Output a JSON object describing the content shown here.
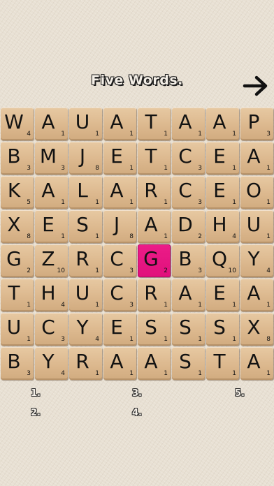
{
  "game": {
    "title": "Five Words.",
    "next_icon": "arrow-right-icon",
    "selected_color": "#e8148a"
  },
  "board": {
    "rows": [
      [
        {
          "l": "W",
          "s": "4"
        },
        {
          "l": "A",
          "s": "1"
        },
        {
          "l": "U",
          "s": "1"
        },
        {
          "l": "A",
          "s": "1"
        },
        {
          "l": "T",
          "s": "1"
        },
        {
          "l": "A",
          "s": "1"
        },
        {
          "l": "A",
          "s": "1"
        },
        {
          "l": "P",
          "s": "3"
        }
      ],
      [
        {
          "l": "B",
          "s": "3"
        },
        {
          "l": "M",
          "s": "3"
        },
        {
          "l": "J",
          "s": "8"
        },
        {
          "l": "E",
          "s": "1"
        },
        {
          "l": "T",
          "s": "1"
        },
        {
          "l": "C",
          "s": "3"
        },
        {
          "l": "E",
          "s": "1"
        },
        {
          "l": "A",
          "s": "1"
        }
      ],
      [
        {
          "l": "K",
          "s": "5"
        },
        {
          "l": "A",
          "s": "1"
        },
        {
          "l": "L",
          "s": "1"
        },
        {
          "l": "A",
          "s": "1"
        },
        {
          "l": "R",
          "s": "1"
        },
        {
          "l": "C",
          "s": "3"
        },
        {
          "l": "E",
          "s": "1"
        },
        {
          "l": "O",
          "s": "1"
        }
      ],
      [
        {
          "l": "X",
          "s": "8"
        },
        {
          "l": "E",
          "s": "1"
        },
        {
          "l": "S",
          "s": "1"
        },
        {
          "l": "J",
          "s": "8"
        },
        {
          "l": "A",
          "s": "1"
        },
        {
          "l": "D",
          "s": "2"
        },
        {
          "l": "H",
          "s": "4"
        },
        {
          "l": "U",
          "s": "1"
        }
      ],
      [
        {
          "l": "G",
          "s": "2"
        },
        {
          "l": "Z",
          "s": "10"
        },
        {
          "l": "R",
          "s": "1"
        },
        {
          "l": "C",
          "s": "3"
        },
        {
          "l": "G",
          "s": "2",
          "selected": true
        },
        {
          "l": "B",
          "s": "3"
        },
        {
          "l": "Q",
          "s": "10"
        },
        {
          "l": "Y",
          "s": "4"
        }
      ],
      [
        {
          "l": "T",
          "s": "1"
        },
        {
          "l": "H",
          "s": "4"
        },
        {
          "l": "U",
          "s": "1"
        },
        {
          "l": "C",
          "s": "3"
        },
        {
          "l": "R",
          "s": "1"
        },
        {
          "l": "A",
          "s": "1"
        },
        {
          "l": "E",
          "s": "1"
        },
        {
          "l": "A",
          "s": "1"
        }
      ],
      [
        {
          "l": "U",
          "s": "1"
        },
        {
          "l": "C",
          "s": "3"
        },
        {
          "l": "Y",
          "s": "4"
        },
        {
          "l": "E",
          "s": "1"
        },
        {
          "l": "S",
          "s": "1"
        },
        {
          "l": "S",
          "s": "1"
        },
        {
          "l": "S",
          "s": "1"
        },
        {
          "l": "X",
          "s": "8"
        }
      ],
      [
        {
          "l": "B",
          "s": "3"
        },
        {
          "l": "Y",
          "s": "4"
        },
        {
          "l": "R",
          "s": "1"
        },
        {
          "l": "A",
          "s": "1"
        },
        {
          "l": "A",
          "s": "1"
        },
        {
          "l": "S",
          "s": "1"
        },
        {
          "l": "T",
          "s": "1"
        },
        {
          "l": "A",
          "s": "1"
        }
      ]
    ]
  },
  "word_slots": [
    "1.",
    "2.",
    "3.",
    "4.",
    "5."
  ]
}
